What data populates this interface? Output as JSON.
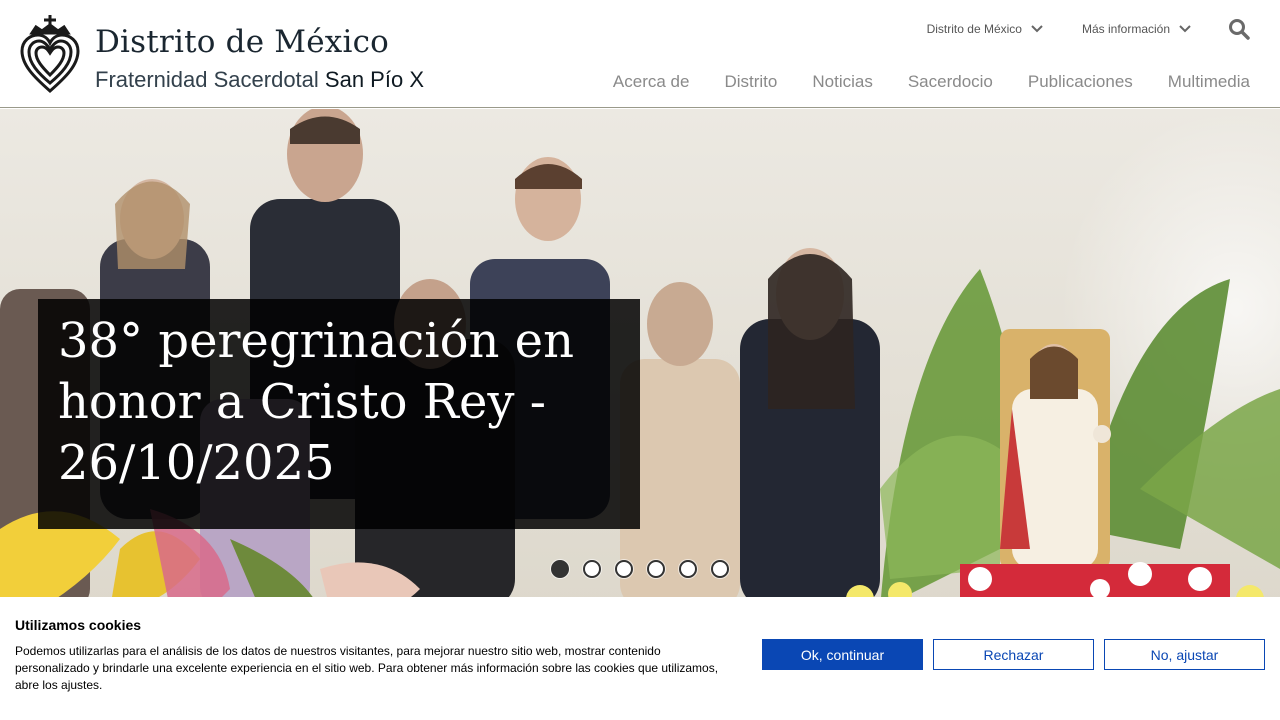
{
  "brand": {
    "title": "Distrito de México",
    "subtitle_light": "Fraternidad Sacerdotal",
    "subtitle_strong": "San Pío X"
  },
  "utility_nav": [
    {
      "label": "Distrito de México",
      "icon": "chevron-down-icon"
    },
    {
      "label": "Más información",
      "icon": "chevron-down-icon"
    }
  ],
  "search_icon": "search-icon",
  "main_nav": [
    "Acerca de",
    "Distrito",
    "Noticias",
    "Sacerdocio",
    "Publicaciones",
    "Multimedia"
  ],
  "hero": {
    "caption": "38° peregrinación en honor a Cristo Rey - 26/10/2025",
    "slide_count": 6,
    "active_slide": 1
  },
  "cookie": {
    "title": "Utilizamos cookies",
    "text": "Podemos utilizarlas para el análisis de los datos de nuestros visitantes, para mejorar nuestro sitio web, mostrar contenido personalizado y brindarle una excelente experiencia en el sitio web. Para obtener más información sobre las cookies que utilizamos, abre los ajustes.",
    "buttons": {
      "accept": "Ok, continuar",
      "reject": "Rechazar",
      "settings": "No, ajustar"
    }
  },
  "colors": {
    "brand_dark": "#1a2630",
    "nav_gray": "#8a8a8a",
    "cookie_blue": "#0a47b4"
  }
}
